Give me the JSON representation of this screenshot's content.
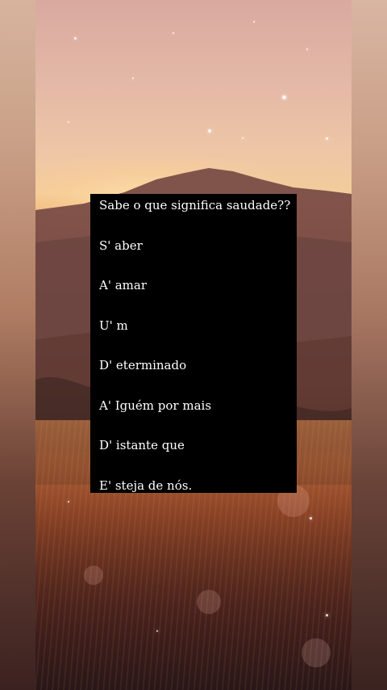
{
  "overlay": {
    "lines": [
      "Sabe o que significa saudade??",
      "S' aber",
      "A' amar",
      "U' m",
      "D' eterminado",
      "A' Iguém por mais",
      "D' istante que",
      "E' steja de nós."
    ]
  },
  "colors": {
    "overlay_background": "#000000",
    "overlay_text": "#ffffff"
  }
}
